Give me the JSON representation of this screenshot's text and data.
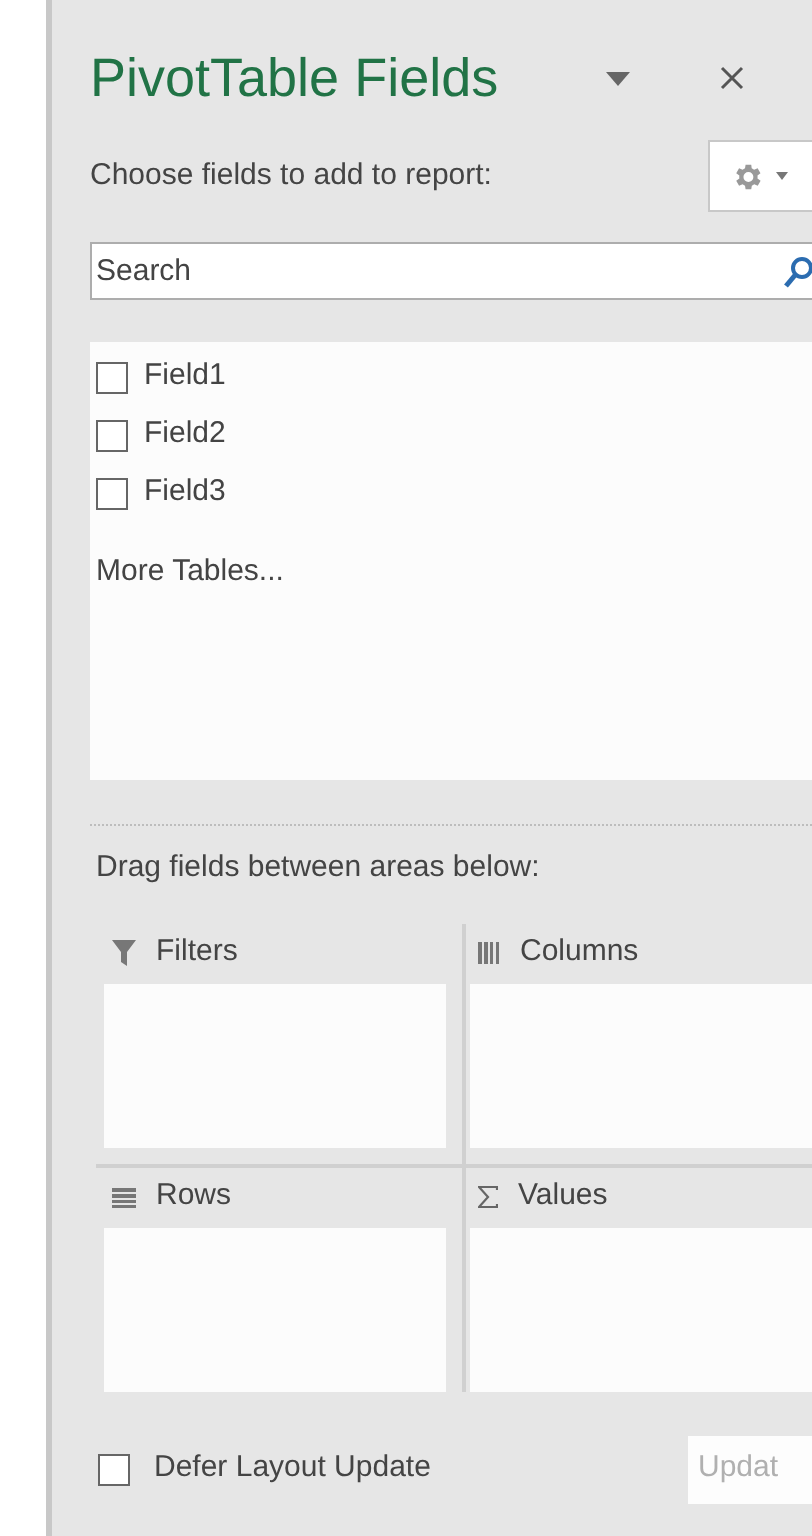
{
  "panel": {
    "title": "PivotTable Fields",
    "subtitle": "Choose fields to add to report:"
  },
  "search": {
    "placeholder": "Search"
  },
  "fields": [
    {
      "label": "Field1",
      "checked": false
    },
    {
      "label": "Field2",
      "checked": false
    },
    {
      "label": "Field3",
      "checked": false
    }
  ],
  "more_tables": "More Tables...",
  "areas_hint": "Drag fields between areas below:",
  "areas": [
    {
      "kind": "filters",
      "label": "Filters"
    },
    {
      "kind": "columns",
      "label": "Columns"
    },
    {
      "kind": "rows",
      "label": "Rows"
    },
    {
      "kind": "values",
      "label": "Values"
    }
  ],
  "defer": {
    "label": "Defer Layout Update",
    "checked": false
  },
  "update_button": {
    "label": "Updat",
    "disabled": true
  }
}
